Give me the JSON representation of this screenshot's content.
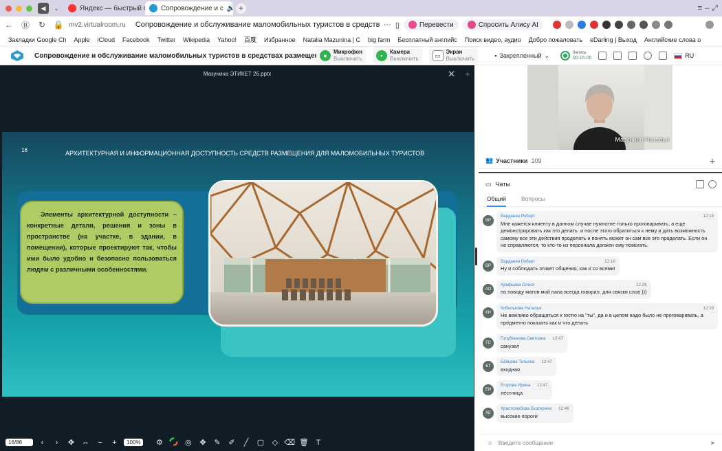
{
  "browser": {
    "tabs": [
      {
        "label": "Яндекс — быстрый поиск",
        "active": false
      },
      {
        "label": "Сопровождение и с",
        "active": true
      }
    ],
    "new_tab": "+",
    "url": "mv2.virtualroom.ru",
    "page_title": "Сопровождение и обслуживание маломобильных туристов в средствах раз...",
    "menu_dots": "···",
    "translate_label": "Перевести",
    "alice_label": "Спросить Алису AI",
    "bookmarks": [
      "Закладки Google Ch",
      "Apple",
      "iCloud",
      "Facebook",
      "Twitter",
      "Wikipedia",
      "Yahoo!",
      "百度",
      "Избранное",
      "Natalia Mazunina | C",
      "big farm",
      "Бесплатный английс",
      "Поиск видео, аудио",
      "Добро пожаловать",
      "eDarling | Выход",
      "Английские слова о"
    ]
  },
  "app": {
    "title": "Сопровождение и обслуживание маломобильных туристов в средствах размещения",
    "mic": {
      "label": "Микрофон",
      "state": "Выключить"
    },
    "camera": {
      "label": "Камера",
      "state": "Выключить"
    },
    "screen": {
      "label": "Экран",
      "state": "Выключить"
    },
    "pinned": "Закрепленный",
    "record": {
      "label": "Запись",
      "time": "00:15:06"
    },
    "lang": "RU"
  },
  "presentation": {
    "filename": "Мазунина ЭТИКЕТ 26.pptx",
    "slide_number": "16",
    "slide_title": "АРХИТЕКТУРНАЯ И ИНФОРМАЦИОННАЯ ДОСТУПНОСТЬ СРЕДСТВ РАЗМЕЩЕНИЯ ДЛЯ МАЛОМОБИЛЬНЫХ ТУРИСТОВ",
    "slide_text": "Элементы архитектурной доступности – конкретные детали, решения и зоны в пространстве (на участке, в здании, в помещении), которые проектируют так, чтобы ими было удобно и безопасно пользоваться людям с различными особенностями.",
    "page_indicator": "16/86",
    "zoom": "100%"
  },
  "video": {
    "name": "Мазунина Наталья"
  },
  "participants": {
    "label": "Участники",
    "count": "109"
  },
  "chat": {
    "title": "Чаты",
    "tabs": [
      "Общий",
      "Вопросы"
    ],
    "input_placeholder": "Введите сообщение",
    "messages": [
      {
        "initials": "ВР",
        "name": "Варданян Роберт",
        "time": "12:18",
        "text": "Мне кажется клиенту в данном случае нужнотне только проговаривать, а еще демонстрировать как это делать. и после этого обратиться к нему и дать возможность самому все эти действия проделать и понять может он сам все это проделать. Если он не справляются, то кто-то из персонала должен ему помогать."
      },
      {
        "initials": "ВР",
        "name": "Варданян Роберт",
        "time": "12:19",
        "text": "Ну и соблюдать этикет общения, как и со всеми!"
      },
      {
        "initials": "АО",
        "name": "Арефьева Олеся",
        "time": "12:26",
        "text": "по поводу матов мой папа всегда говорил. для связки слов )))"
      },
      {
        "initials": "КН",
        "name": "Кобелькова Наталья",
        "time": "12:29",
        "text": "Не вежливо обращаться к гостю на \"ты\", да и в целом надо было не проговаривать, а предметно показать как и что делать"
      },
      {
        "initials": "ГС",
        "name": "Голубникова Светлана",
        "time": "12:47",
        "text": "санузел"
      },
      {
        "initials": "БТ",
        "name": "Байцева Татьяна",
        "time": "12:47",
        "text": "входная"
      },
      {
        "initials": "ЕИ",
        "name": "Егорова Ирина",
        "time": "12:47",
        "text": "лестница"
      },
      {
        "initials": "ХЕ",
        "name": "Христолюбова Екатерина",
        "time": "12:48",
        "text": "высокие пороги"
      }
    ]
  },
  "colors": {
    "accent": "#3a8df5",
    "record": "#25a957",
    "slide_box": "#aecb64",
    "mic": "#2fb44e"
  }
}
